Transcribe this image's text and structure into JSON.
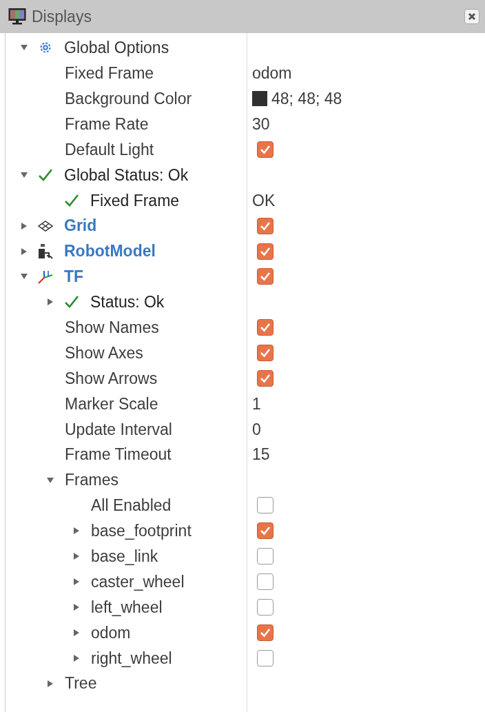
{
  "panel": {
    "title": "Displays"
  },
  "tree": [
    {
      "label": "Global Options",
      "kind": "options",
      "expanded": true,
      "children": [
        {
          "label": "Fixed Frame",
          "kind": "property",
          "value": "odom"
        },
        {
          "label": "Background Color",
          "kind": "property",
          "color": "#303030",
          "value": "48; 48; 48"
        },
        {
          "label": "Frame Rate",
          "kind": "property",
          "value": "30"
        },
        {
          "label": "Default Light",
          "kind": "property",
          "checked": true
        }
      ]
    },
    {
      "label": "Global Status: Ok",
      "kind": "status",
      "expanded": true,
      "children": [
        {
          "label": "Fixed Frame",
          "kind": "status",
          "value": "OK"
        }
      ]
    },
    {
      "label": "Grid",
      "kind": "grid",
      "expanded": false,
      "checked": true
    },
    {
      "label": "RobotModel",
      "kind": "robot",
      "expanded": false,
      "checked": true
    },
    {
      "label": "TF",
      "kind": "tf",
      "expanded": true,
      "checked": true,
      "children": [
        {
          "label": "Status: Ok",
          "kind": "status",
          "expanded": false
        },
        {
          "label": "Show Names",
          "kind": "property",
          "checked": true
        },
        {
          "label": "Show Axes",
          "kind": "property",
          "checked": true
        },
        {
          "label": "Show Arrows",
          "kind": "property",
          "checked": true
        },
        {
          "label": "Marker Scale",
          "kind": "property",
          "value": "1"
        },
        {
          "label": "Update Interval",
          "kind": "property",
          "value": "0"
        },
        {
          "label": "Frame Timeout",
          "kind": "property",
          "value": "15"
        },
        {
          "label": "Frames",
          "kind": "property",
          "expanded": true,
          "children": [
            {
              "label": "All Enabled",
              "kind": "property",
              "checked": false
            },
            {
              "label": "base_footprint",
              "kind": "property",
              "expanded": false,
              "checked": true
            },
            {
              "label": "base_link",
              "kind": "property",
              "expanded": false,
              "checked": false
            },
            {
              "label": "caster_wheel",
              "kind": "property",
              "expanded": false,
              "checked": false
            },
            {
              "label": "left_wheel",
              "kind": "property",
              "expanded": false,
              "checked": false
            },
            {
              "label": "odom",
              "kind": "property",
              "expanded": false,
              "checked": true
            },
            {
              "label": "right_wheel",
              "kind": "property",
              "expanded": false,
              "checked": false
            }
          ]
        },
        {
          "label": "Tree",
          "kind": "property",
          "expanded": false
        }
      ]
    }
  ]
}
